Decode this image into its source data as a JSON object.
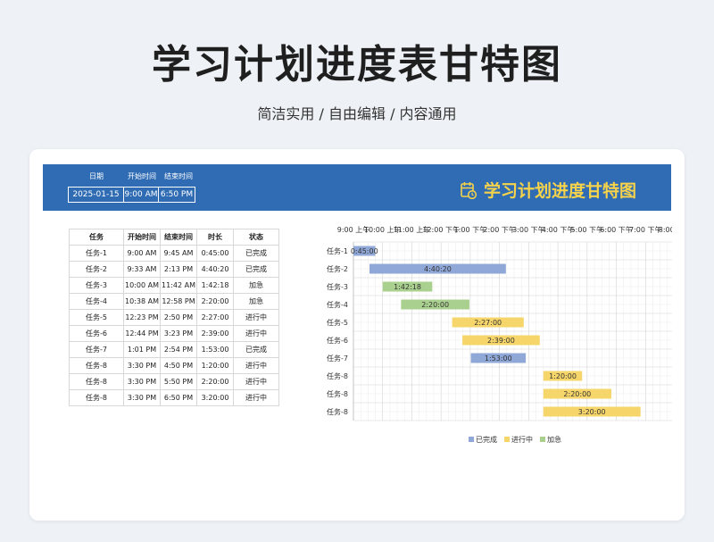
{
  "page": {
    "title": "学习计划进度表甘特图",
    "subtitle": "简洁实用 / 自由编辑 / 内容通用"
  },
  "header": {
    "date_label": "日期",
    "start_label": "开始时间",
    "end_label": "结束时间",
    "date_value": "2025-01-15",
    "start_value": "9:00 AM",
    "end_value": "6:50 PM",
    "chart_title": "学习计划进度甘特图"
  },
  "table": {
    "columns": [
      "任务",
      "开始时间",
      "结束时间",
      "时长",
      "状态"
    ],
    "rows": [
      [
        "任务-1",
        "9:00 AM",
        "9:45 AM",
        "0:45:00",
        "已完成"
      ],
      [
        "任务-2",
        "9:33 AM",
        "2:13 PM",
        "4:40:20",
        "已完成"
      ],
      [
        "任务-3",
        "10:00 AM",
        "11:42 AM",
        "1:42:18",
        "加急"
      ],
      [
        "任务-4",
        "10:38 AM",
        "12:58 PM",
        "2:20:00",
        "加急"
      ],
      [
        "任务-5",
        "12:23 PM",
        "2:50 PM",
        "2:27:00",
        "进行中"
      ],
      [
        "任务-6",
        "12:44 PM",
        "3:23 PM",
        "2:39:00",
        "进行中"
      ],
      [
        "任务-7",
        "1:01 PM",
        "2:54 PM",
        "1:53:00",
        "已完成"
      ],
      [
        "任务-8",
        "3:30 PM",
        "4:50 PM",
        "1:20:00",
        "进行中"
      ],
      [
        "任务-8",
        "3:30 PM",
        "5:50 PM",
        "2:20:00",
        "进行中"
      ],
      [
        "任务-8",
        "3:30 PM",
        "6:50 PM",
        "3:20:00",
        "进行中"
      ]
    ]
  },
  "colors": {
    "已完成": "#8fa8d8",
    "进行中": "#f6d56a",
    "加急": "#a9d08e"
  },
  "chart_data": {
    "type": "bar",
    "orientation": "horizontal-gantt",
    "x_tick_labels": [
      "9:00 上午",
      "10:00 上午",
      "11:00 上午",
      "12:00 下午",
      "1:00 下午",
      "2:00 下午",
      "3:00 下午",
      "4:00 下午",
      "5:00 下午",
      "6:00 下午",
      "7:00 下午",
      "8:00 下午"
    ],
    "xlim_hours": [
      9,
      20
    ],
    "grid": true,
    "legend_position": "bottom",
    "legend": [
      "已完成",
      "进行中",
      "加急"
    ],
    "tasks": [
      {
        "name": "任务-1",
        "start": 9.0,
        "end": 9.75,
        "label": "0:45:00",
        "status": "已完成"
      },
      {
        "name": "任务-2",
        "start": 9.55,
        "end": 14.22,
        "label": "4:40:20",
        "status": "已完成"
      },
      {
        "name": "任务-3",
        "start": 10.0,
        "end": 11.7,
        "label": "1:42:18",
        "status": "加急"
      },
      {
        "name": "任务-4",
        "start": 10.63,
        "end": 12.97,
        "label": "2:20:00",
        "status": "加急"
      },
      {
        "name": "任务-5",
        "start": 12.38,
        "end": 14.83,
        "label": "2:27:00",
        "status": "进行中"
      },
      {
        "name": "任务-6",
        "start": 12.73,
        "end": 15.38,
        "label": "2:39:00",
        "status": "进行中"
      },
      {
        "name": "任务-7",
        "start": 13.02,
        "end": 14.9,
        "label": "1:53:00",
        "status": "已完成"
      },
      {
        "name": "任务-8",
        "start": 15.5,
        "end": 16.83,
        "label": "1:20:00",
        "status": "进行中"
      },
      {
        "name": "任务-8",
        "start": 15.5,
        "end": 17.83,
        "label": "2:20:00",
        "status": "进行中"
      },
      {
        "name": "任务-8",
        "start": 15.5,
        "end": 18.83,
        "label": "3:20:00",
        "status": "进行中"
      }
    ]
  }
}
